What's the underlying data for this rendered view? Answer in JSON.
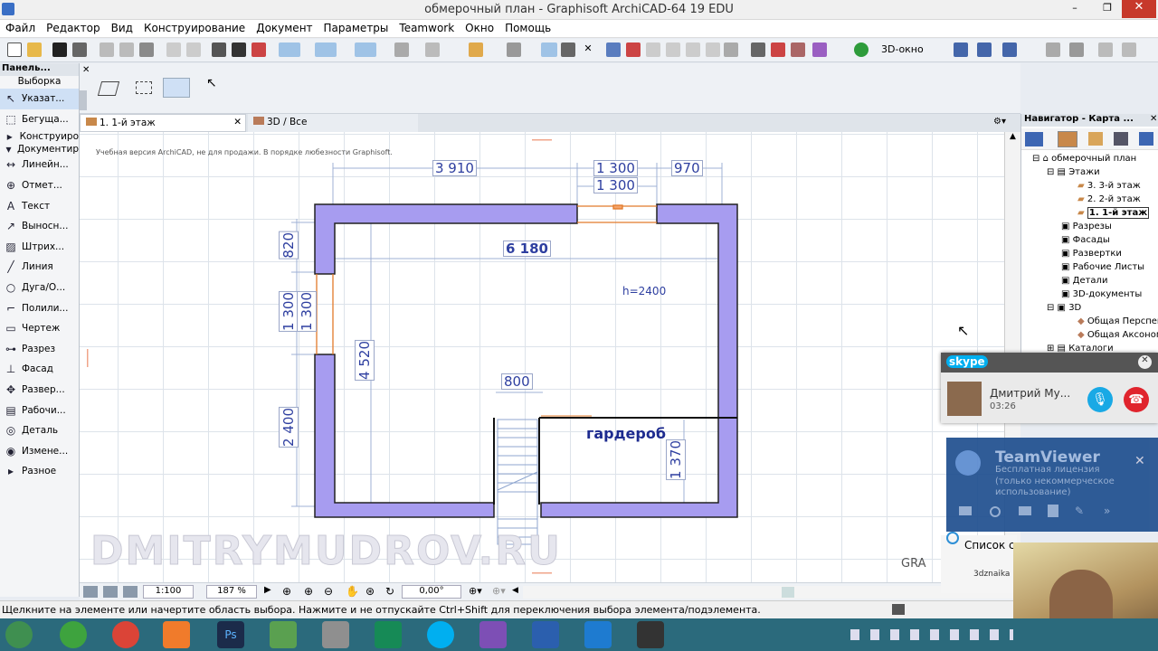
{
  "window": {
    "title": "обмерочный план - Graphisoft ArchiCAD-64 19 EDU"
  },
  "menu": [
    "Файл",
    "Редактор",
    "Вид",
    "Конструирование",
    "Документ",
    "Параметры",
    "Teamwork",
    "Окно",
    "Помощь"
  ],
  "toolbar": {
    "btn_3d_window": "3D-окно"
  },
  "panel": {
    "title": "Панель...",
    "selection": "Выборка",
    "items": [
      "Указат...",
      "Бегуща...",
      "Конструиро",
      "Документир",
      "Линейн...",
      "Отмет...",
      "Текст",
      "Выносн...",
      "Штрих...",
      "Линия",
      "Дуга/О...",
      "Полили...",
      "Чертеж",
      "Разрез",
      "Фасад",
      "Развер...",
      "Рабочи...",
      "Деталь",
      "Измене...",
      "Разное"
    ]
  },
  "tabs": [
    {
      "label": "1. 1-й этаж"
    },
    {
      "label": "3D / Все"
    }
  ],
  "canvas": {
    "notice": "Учебная версия ArchiCAD, не для продажи. В порядке любезности Graphisoft.",
    "room_label": "гардероб",
    "height_label": "h=2400",
    "watermark": "DMITRYMUDROV.RU",
    "partial_text": "GRA",
    "dims": {
      "d3910": "3 910",
      "d1300a": "1 300",
      "d1300b": "1 300",
      "d970": "970",
      "d6180": "6 180",
      "d820": "820",
      "d1300c": "1 300",
      "d1300d": "1 300",
      "d4520": "4 520",
      "d2400": "2 400",
      "d800": "800",
      "d1370": "1 370"
    }
  },
  "bottombar": {
    "scale": "1:100",
    "zoom": "187 %",
    "angle": "0,00°"
  },
  "status": "Щелкните на элементе или начертите область выбора. Нажмите и не отпускайте Ctrl+Shift для переключения выбора элемента/подэлемента.",
  "navigator": {
    "title": "Навигатор - Карта ...",
    "tree": [
      "обмерочный план",
      "Этажи",
      "3. 3-й этаж",
      "2. 2-й этаж",
      "1. 1-й этаж",
      "Разрезы",
      "Фасады",
      "Развертки",
      "Рабочие Листы",
      "Детали",
      "3D-документы",
      "3D",
      "Общая Перспек",
      "Общая Аксоном",
      "Каталоги"
    ]
  },
  "skype": {
    "brand": "skype",
    "caller": "Дмитрий Му...",
    "time": "03:26"
  },
  "teamviewer": {
    "brand": "TeamViewer",
    "line1": "Бесплатная лицензия",
    "line2": "(только некоммерческое",
    "line3": "использование)"
  },
  "overlay": {
    "list_label": "Список с",
    "user": "3dznaika"
  },
  "colors": {
    "wall": "#a79cf0",
    "dim_text": "#2e3fa0",
    "taskbar": "#2b6a7c"
  }
}
